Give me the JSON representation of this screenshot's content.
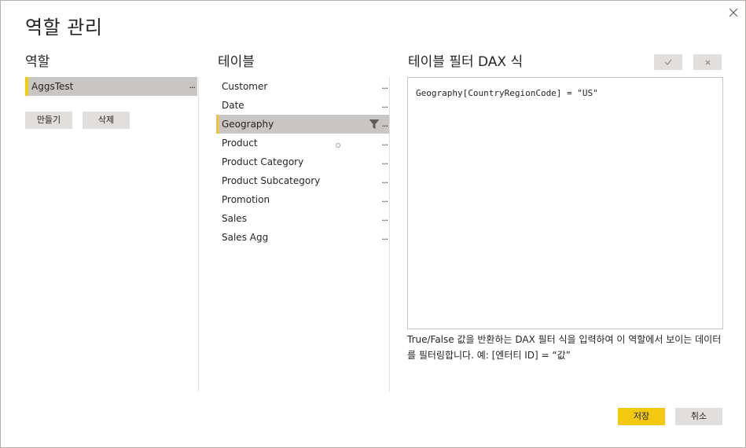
{
  "dialog": {
    "title": "역할 관리"
  },
  "roles": {
    "header": "역할",
    "items": [
      {
        "label": "AggsTest",
        "more": "..."
      }
    ],
    "create_label": "만들기",
    "delete_label": "삭제"
  },
  "tables": {
    "header": "테이블",
    "items": [
      {
        "label": "Customer",
        "more": "..."
      },
      {
        "label": "Date",
        "more": "..."
      },
      {
        "label": "Geography",
        "more": "..."
      },
      {
        "label": "Product",
        "more": "..."
      },
      {
        "label": "Product Category",
        "more": "..."
      },
      {
        "label": "Product Subcategory",
        "more": "..."
      },
      {
        "label": "Promotion",
        "more": "..."
      },
      {
        "label": "Sales",
        "more": "..."
      },
      {
        "label": "Sales Agg",
        "more": "..."
      }
    ]
  },
  "dax": {
    "header": "테이블 필터 DAX 식",
    "expression": "Geography[CountryRegionCode] = \"US\"",
    "hint": "True/False 값을 반환하는 DAX 필터 식을 입력하여 이 역할에서 보이는 데이터를 필터링합니다. 예: [엔터티 ID] = “값”"
  },
  "footer": {
    "save_label": "저장",
    "cancel_label": "취소"
  },
  "colors": {
    "accent": "#f2c811",
    "selected_bg": "#c8c6c4",
    "button_bg": "#e1dfdd"
  },
  "icons": {
    "close": "close-icon",
    "check": "check-icon",
    "x": "x-icon",
    "filter": "filter-icon"
  }
}
